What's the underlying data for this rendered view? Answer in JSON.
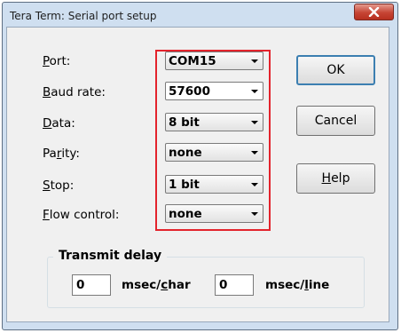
{
  "window": {
    "title": "Tera Term: Serial port setup"
  },
  "fields": [
    {
      "label_pre": "",
      "label_key": "P",
      "label_post": "ort:",
      "value": "COM15"
    },
    {
      "label_pre": "",
      "label_key": "B",
      "label_post": "aud rate:",
      "value": "57600"
    },
    {
      "label_pre": "",
      "label_key": "D",
      "label_post": "ata:",
      "value": "8 bit"
    },
    {
      "label_pre": "Pa",
      "label_key": "r",
      "label_post": "ity:",
      "value": "none"
    },
    {
      "label_pre": "",
      "label_key": "S",
      "label_post": "top:",
      "value": "1 bit"
    },
    {
      "label_pre": "",
      "label_key": "F",
      "label_post": "low control:",
      "value": "none"
    }
  ],
  "buttons": {
    "ok": "OK",
    "cancel": "Cancel",
    "help_key": "H",
    "help_rest": "elp"
  },
  "transmit_delay": {
    "title": "Transmit delay",
    "char_value": "0",
    "char_pre": "msec/",
    "char_key": "c",
    "char_post": "har",
    "line_value": "0",
    "line_pre": "msec/",
    "line_key": "l",
    "line_post": "ine"
  }
}
